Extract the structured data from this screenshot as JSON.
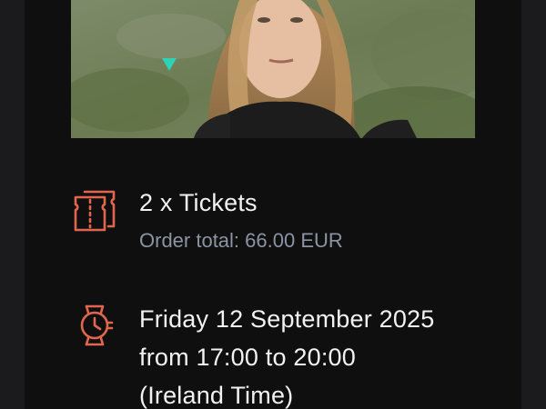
{
  "event": {
    "image_alt": "Artist portrait"
  },
  "tickets": {
    "title": "2 x Tickets",
    "order_total": "Order total: 66.00 EUR",
    "icon": "ticket-icon"
  },
  "schedule": {
    "date": "Friday 12 September 2025",
    "time": "from 17:00 to 20:00",
    "timezone": "(Ireland Time)",
    "icon": "watch-icon"
  },
  "colors": {
    "accent": "#e2664e",
    "background": "#0f0f10",
    "text": "#f2f2f2",
    "muted": "#8c93a3"
  }
}
